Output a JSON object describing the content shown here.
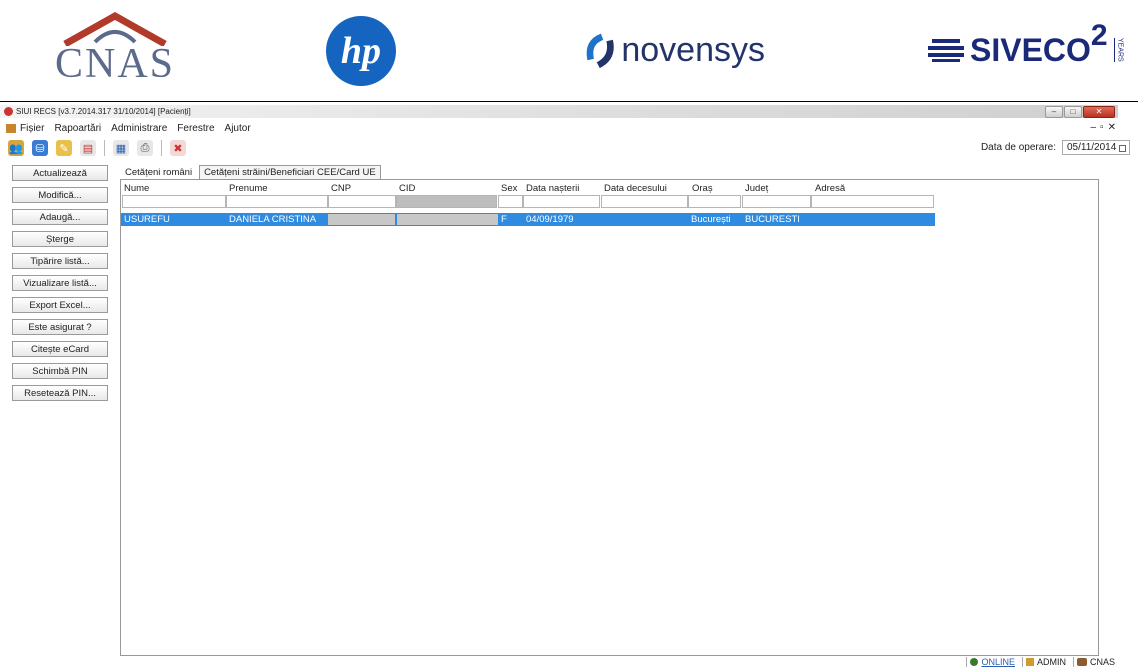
{
  "header_logos": {
    "cnas": "CNAS",
    "hp": "hp",
    "novensys": "novensys",
    "siveco": "SIVECO",
    "siveco_sup": "2",
    "siveco_years": "YEARS"
  },
  "window": {
    "title": "SIUI RECS [v3.7.2014.317  31/10/2014]  [Pacienți]"
  },
  "menu": {
    "items": [
      "Fișier",
      "Rapoartări",
      "Administrare",
      "Ferestre",
      "Ajutor"
    ]
  },
  "toolbar": {
    "operation_date_label": "Data de operare:",
    "operation_date_value": "05/11/2014"
  },
  "side_buttons": [
    "Actualizează",
    "Modifică...",
    "Adaugă...",
    "Șterge",
    "Tipărire listă...",
    "Vizualizare listă...",
    "Export Excel...",
    "Este asigurat ?",
    "Citește eCard",
    "Schimbă PIN",
    "Resetează PIN..."
  ],
  "tabs": [
    "Cetățeni români",
    "Cetățeni străini/Beneficiari CEE/Card UE"
  ],
  "grid": {
    "columns": [
      "Nume",
      "Prenume",
      "CNP",
      "CID",
      "Sex",
      "Data nașterii",
      "Data decesului",
      "Oraș",
      "Județ",
      "Adresă"
    ],
    "rows": [
      {
        "nume": "USUREFU",
        "prenume": "DANIELA CRISTINA",
        "cnp": "",
        "cid": "",
        "sex": "F",
        "data_nasterii": "04/09/1979",
        "data_decesului": "",
        "oras": "București",
        "judet": "BUCURESTI",
        "adresa": ""
      }
    ]
  },
  "status": {
    "online": "ONLINE",
    "user": "ADMIN",
    "org": "CNAS"
  },
  "colors": {
    "selection": "#2e8be0",
    "hp_blue": "#1565c0"
  }
}
